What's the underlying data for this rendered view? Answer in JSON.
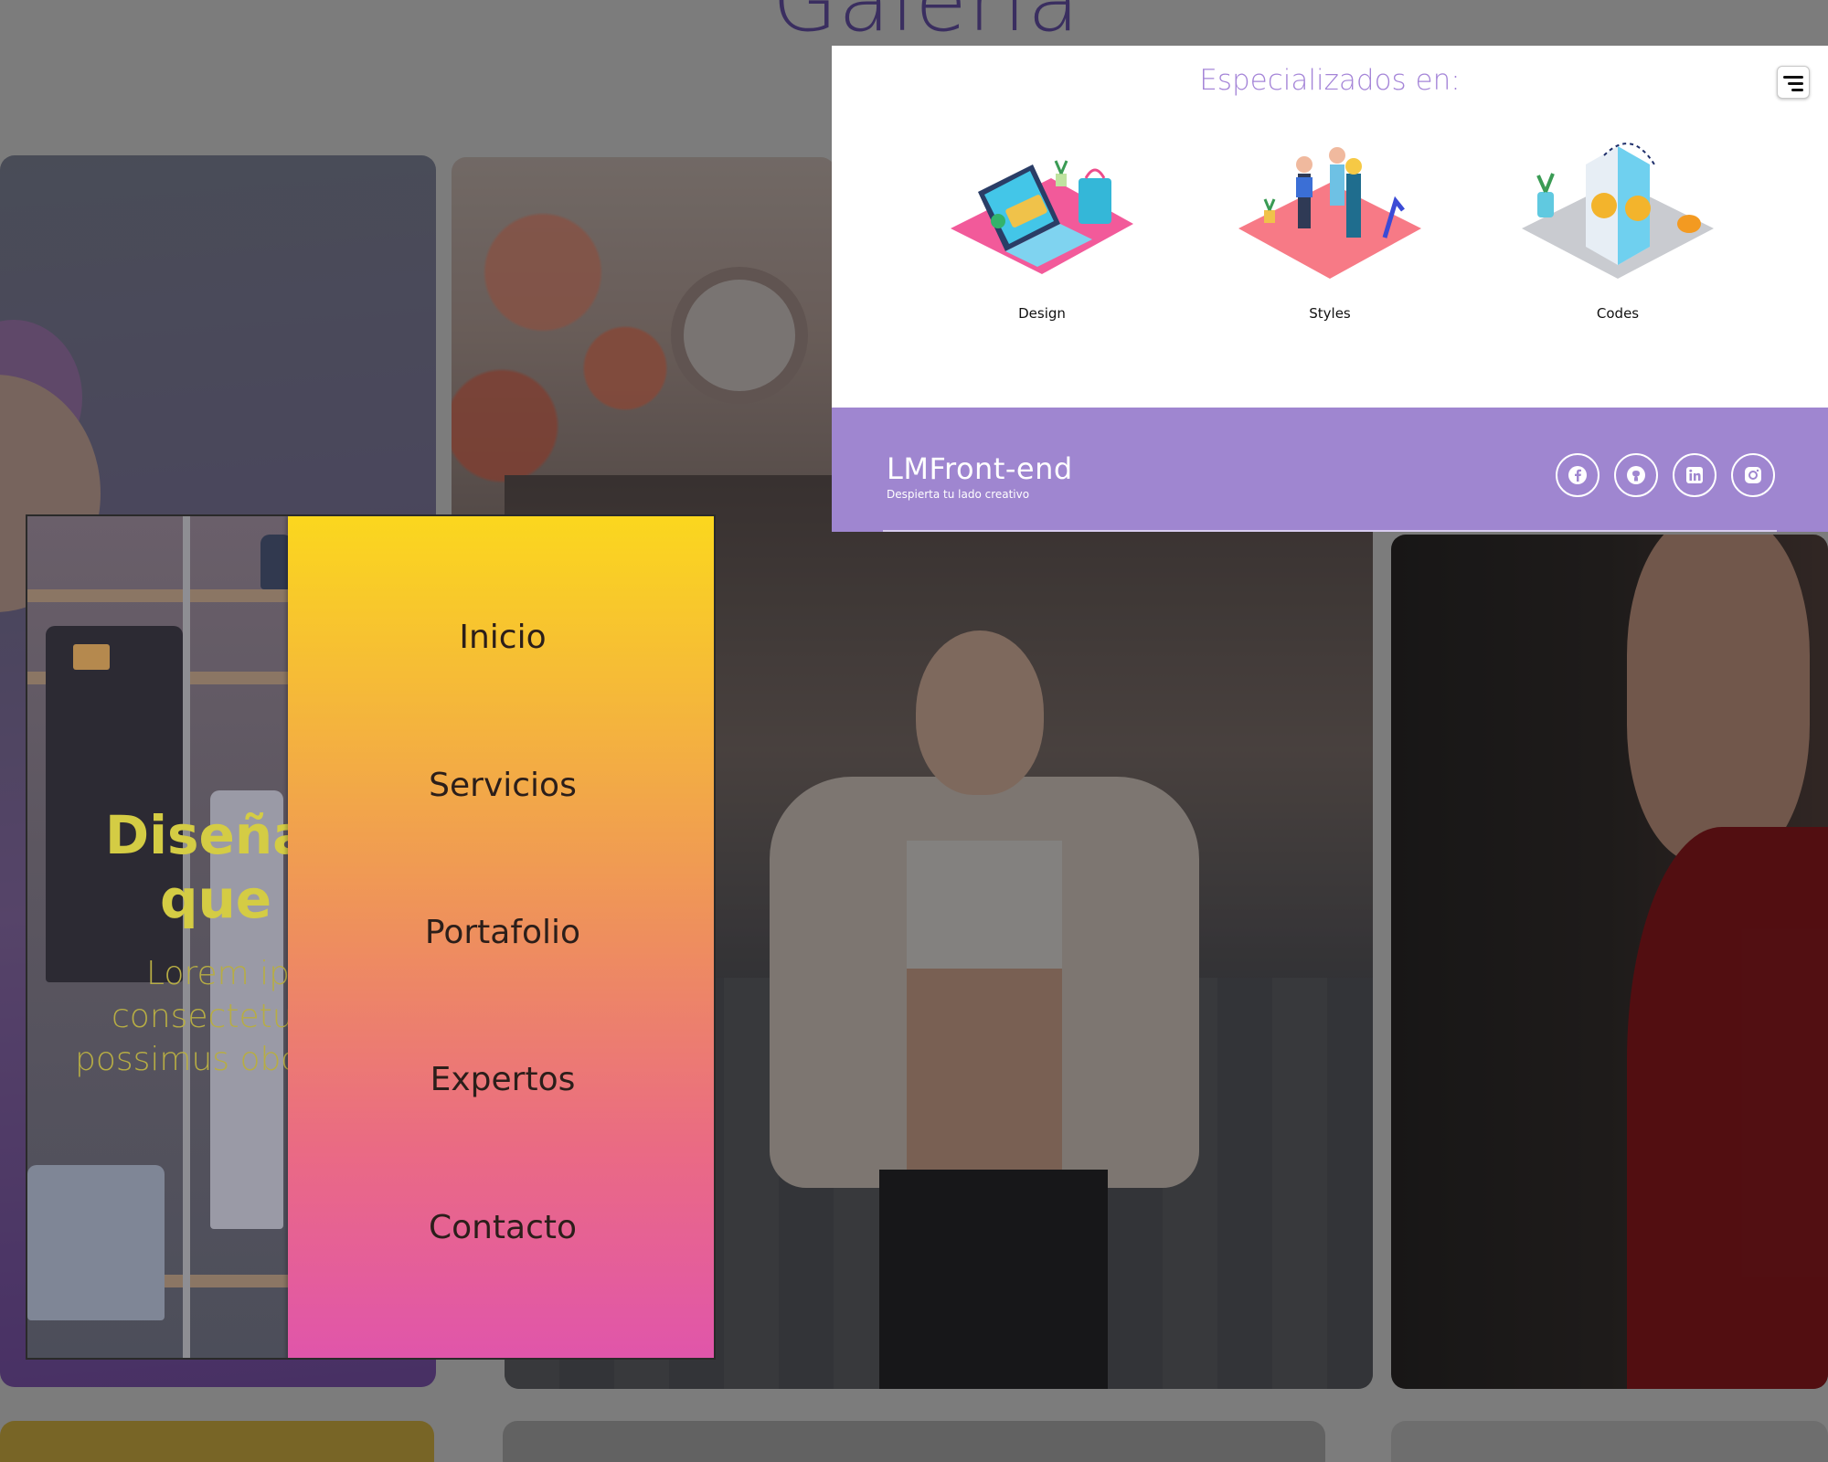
{
  "gallery": {
    "title": "Galería"
  },
  "spec": {
    "title": "Especializados en:",
    "items": [
      {
        "label": "Design",
        "icon": "laptop-card-isometric-icon"
      },
      {
        "label": "Styles",
        "icon": "team-celebration-isometric-icon"
      },
      {
        "label": "Codes",
        "icon": "phone-coins-isometric-icon"
      }
    ],
    "menu_icon": "menu-lines-icon"
  },
  "footer": {
    "brand": "LMFront-end",
    "tagline": "Despierta tu lado creativo",
    "socials": [
      {
        "icon": "facebook-icon"
      },
      {
        "icon": "github-icon"
      },
      {
        "icon": "linkedin-icon"
      },
      {
        "icon": "instagram-icon"
      }
    ]
  },
  "hero": {
    "heading_line1": "Diseña",
    "heading_line2": "que t",
    "para_line1": "Lorem ip",
    "para_line2": "consectetu",
    "para_line3": "possimus obc"
  },
  "nav": {
    "items": [
      "Inicio",
      "Servicios",
      "Portafolio",
      "Expertos",
      "Contacto"
    ]
  },
  "colors": {
    "accent_purple": "#9f86d0",
    "title_purple": "#a585d8",
    "menu_gradient_top": "#fbd71e",
    "menu_gradient_bottom": "#e055ab",
    "hero_yellow": "#d4cc44"
  }
}
